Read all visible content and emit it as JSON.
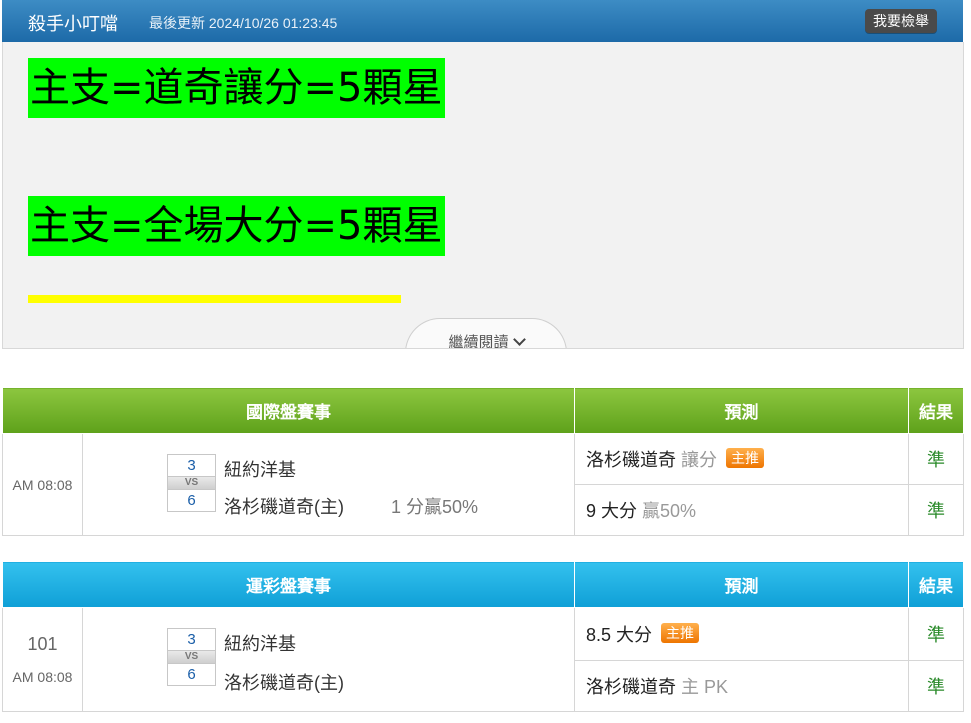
{
  "header": {
    "author": "殺手小叮噹",
    "updated": "最後更新 2024/10/26 01:23:45",
    "report_button": "我要檢舉"
  },
  "article": {
    "picks": [
      "主支=道奇讓分=5顆星",
      "主支=全場大分=5顆星"
    ],
    "highlight_colors": [
      "#00ff00",
      "#00ff00",
      "#ffff00"
    ],
    "read_more": "繼續閱讀"
  },
  "intl": {
    "title": "國際盤賽事",
    "pred_header": "預測",
    "result_header": "結果",
    "time": "AM 08:08",
    "away_score": "3",
    "vs": "VS",
    "home_score": "6",
    "away_team": "紐約洋基",
    "home_team": "洛杉磯道奇(主)",
    "handicap": "1 分贏50%",
    "predictions": [
      {
        "main": "洛杉磯道奇",
        "note": "讓分",
        "badge": "主推",
        "result": "準"
      },
      {
        "main": "9 大分",
        "note": "贏50%",
        "badge": "",
        "result": "準"
      }
    ]
  },
  "sport": {
    "title": "運彩盤賽事",
    "pred_header": "預測",
    "result_header": "結果",
    "game_no": "101",
    "time": "AM 08:08",
    "away_score": "3",
    "vs": "VS",
    "home_score": "6",
    "away_team": "紐約洋基",
    "home_team": "洛杉磯道奇(主)",
    "predictions": [
      {
        "main": "8.5 大分",
        "note": "",
        "badge": "主推",
        "result": "準"
      },
      {
        "main": "洛杉磯道奇",
        "note": "主 PK",
        "badge": "",
        "result": "準"
      }
    ]
  },
  "colors": {
    "header_blue": "#1d6aa8",
    "intl_green": "#5ea11a",
    "sport_blue": "#0f9fd6",
    "badge_orange": "#ee7500",
    "result_green": "#2a8a2a"
  }
}
